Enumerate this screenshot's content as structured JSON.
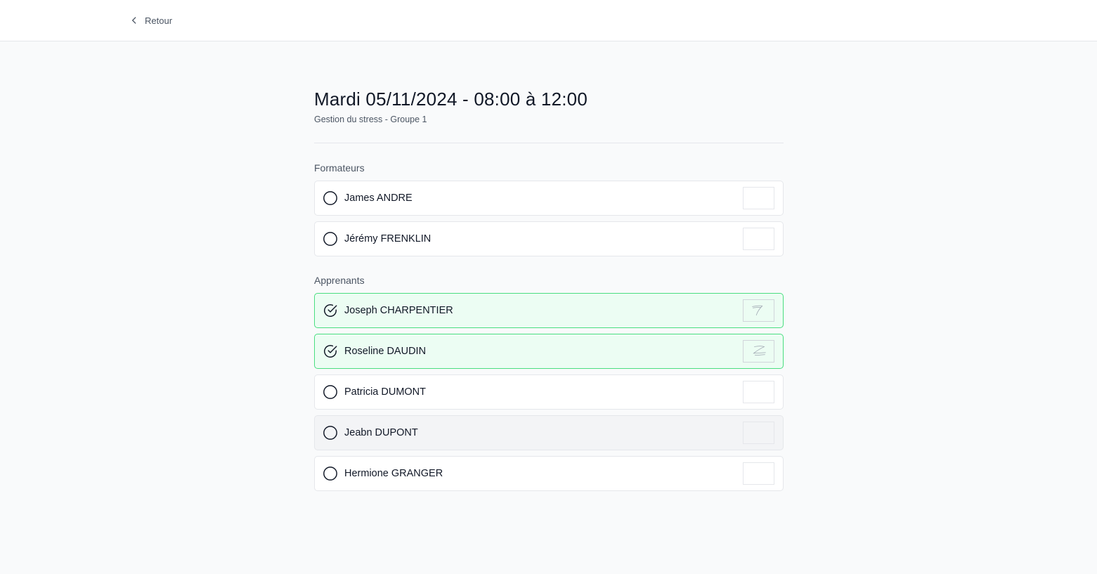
{
  "header": {
    "back_label": "Retour"
  },
  "session": {
    "title": "Mardi 05/11/2024 - 08:00 à 12:00",
    "subtitle": "Gestion du stress - Groupe 1"
  },
  "sections": {
    "trainers_label": "Formateurs",
    "learners_label": "Apprenants"
  },
  "trainers": [
    {
      "name": "James ANDRE",
      "status": "unsigned",
      "icon": "circle-icon"
    },
    {
      "name": "Jérémy FRENKLIN",
      "status": "unsigned",
      "icon": "circle-icon"
    }
  ],
  "learners": [
    {
      "name": "Joseph CHARPENTIER",
      "status": "signed",
      "icon": "check-circle-icon"
    },
    {
      "name": "Roseline DAUDIN",
      "status": "signed",
      "icon": "check-circle-icon"
    },
    {
      "name": "Patricia DUMONT",
      "status": "unsigned",
      "icon": "circle-icon"
    },
    {
      "name": "Jeabn DUPONT",
      "status": "disabled",
      "icon": "circle-icon"
    },
    {
      "name": "Hermione GRANGER",
      "status": "unsigned",
      "icon": "circle-icon"
    }
  ],
  "colors": {
    "signed_bg": "#ecfdf3",
    "signed_border": "#4ade80",
    "disabled_bg": "#f3f4f6",
    "page_bg": "#f9fafb"
  }
}
